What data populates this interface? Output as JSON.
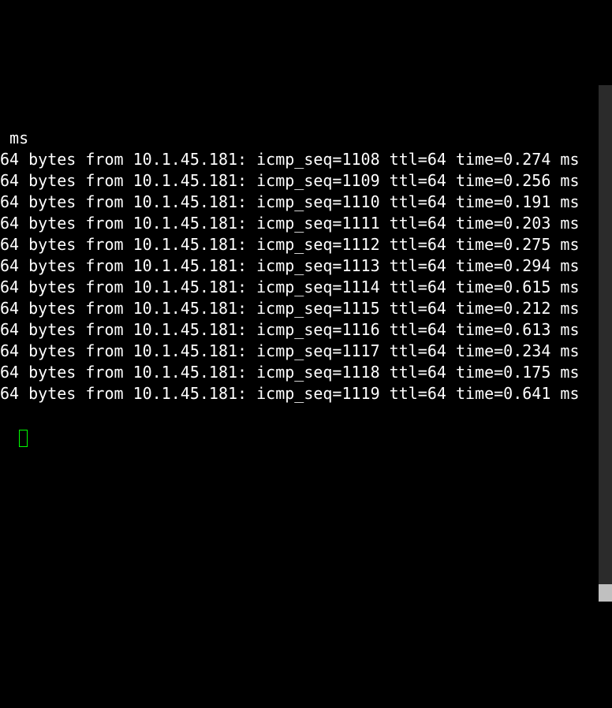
{
  "terminal": {
    "leading_wrap": " ms",
    "source_ip": "10.1.45.181",
    "bytes": 64,
    "ttl": 64,
    "lines": [
      {
        "seq": 1108,
        "time": "0.274"
      },
      {
        "seq": 1109,
        "time": "0.256"
      },
      {
        "seq": 1110,
        "time": "0.191"
      },
      {
        "seq": 1111,
        "time": "0.203"
      },
      {
        "seq": 1112,
        "time": "0.275"
      },
      {
        "seq": 1113,
        "time": "0.294"
      },
      {
        "seq": 1114,
        "time": "0.615"
      },
      {
        "seq": 1115,
        "time": "0.212"
      },
      {
        "seq": 1116,
        "time": "0.613"
      },
      {
        "seq": 1117,
        "time": "0.234"
      },
      {
        "seq": 1118,
        "time": "0.175"
      },
      {
        "seq": 1119,
        "time": "0.641"
      }
    ]
  }
}
